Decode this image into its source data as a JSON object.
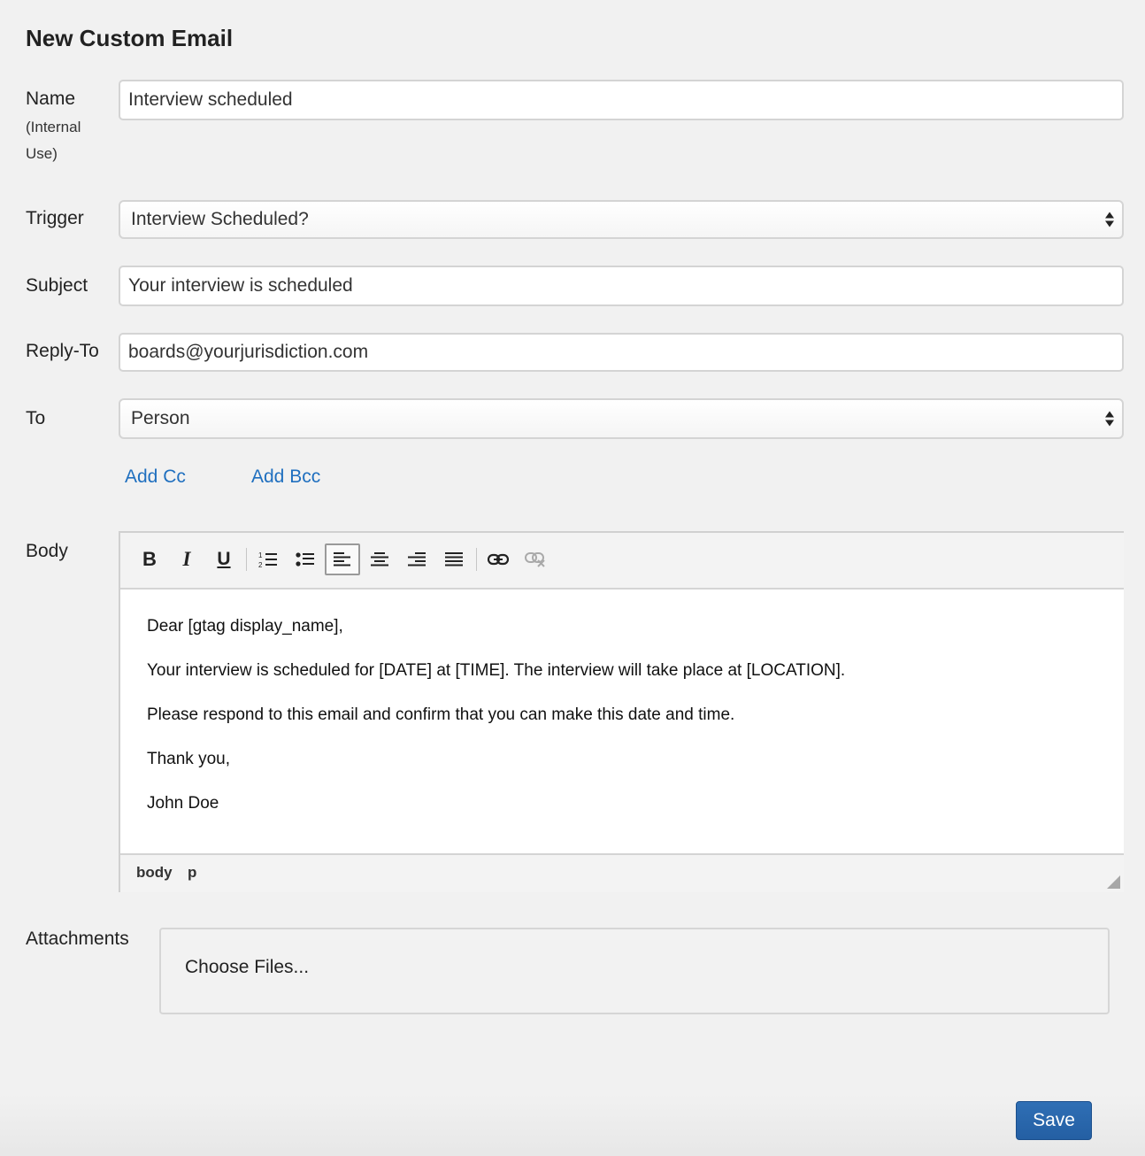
{
  "page": {
    "title": "New Custom Email"
  },
  "form": {
    "name": {
      "label": "Name",
      "sublabel_line1": "(Internal",
      "sublabel_line2": "Use)",
      "value": "Interview scheduled"
    },
    "trigger": {
      "label": "Trigger",
      "selected": "Interview Scheduled?"
    },
    "subject": {
      "label": "Subject",
      "value": "Your interview is scheduled"
    },
    "reply_to": {
      "label": "Reply-To",
      "value": "boards@yourjurisdiction.com"
    },
    "to": {
      "label": "To",
      "selected": "Person"
    },
    "add_cc": "Add Cc",
    "add_bcc": "Add Bcc",
    "body": {
      "label": "Body",
      "toolbar": {
        "bold": "bold-icon",
        "italic": "italic-icon",
        "underline": "underline-icon",
        "ordered_list": "ordered-list-icon",
        "bullet_list": "bullet-list-icon",
        "align_left": "align-left-icon",
        "align_center": "align-center-icon",
        "align_right": "align-right-icon",
        "align_justify": "align-justify-icon",
        "link": "link-icon",
        "unlink": "unlink-icon",
        "active": "align_left"
      },
      "paragraphs": [
        "Dear [gtag display_name],",
        "Your interview is scheduled for [DATE] at [TIME]. The interview will take place at [LOCATION].",
        "Please respond to this email and confirm that you can make this date and time.",
        "Thank you,",
        "John Doe"
      ],
      "path": [
        "body",
        "p"
      ]
    },
    "attachments": {
      "label": "Attachments",
      "button": "Choose Files..."
    },
    "save": "Save"
  },
  "colors": {
    "background": "#f1f1f1",
    "link": "#1f6fbf",
    "primary_button": "#2a67ad"
  }
}
